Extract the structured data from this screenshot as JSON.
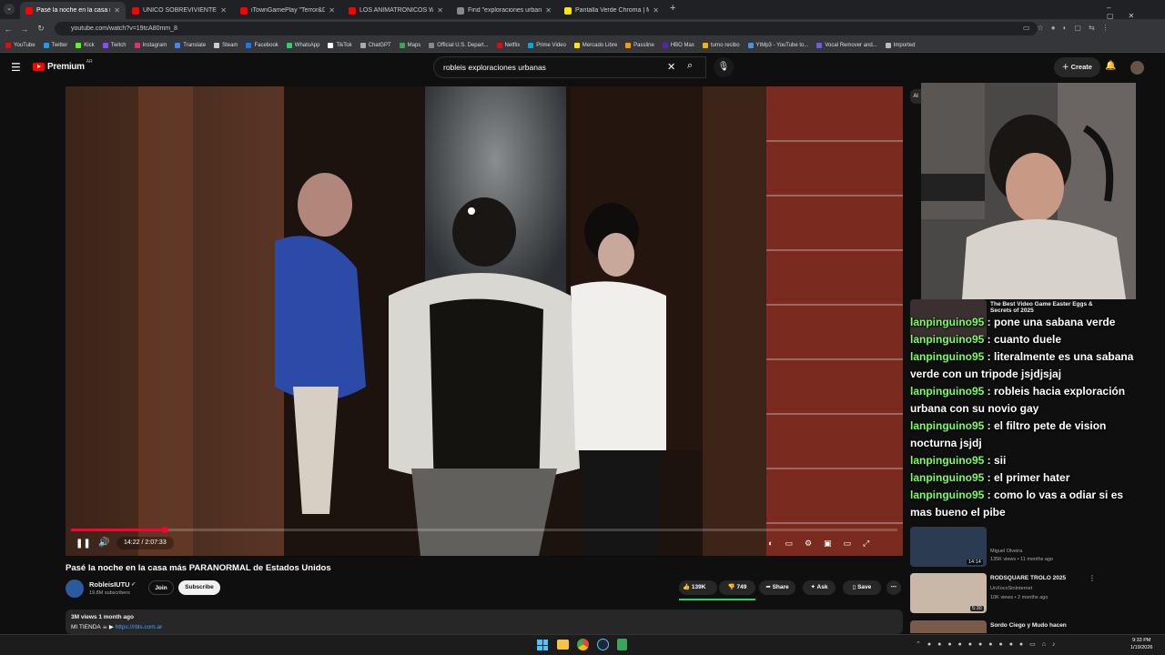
{
  "browser": {
    "tabs": [
      {
        "title": "Pasé la noche en la casa m",
        "color": "#ff0000",
        "active": true
      },
      {
        "title": "UNICO SOBREVIVIENTE | ATRAP",
        "color": "#ff0000"
      },
      {
        "title": "iTownGamePlay \"Terror&Divers",
        "color": "#ff0000"
      },
      {
        "title": "LOS ANIMATRÓNICOS WITHER",
        "color": "#ff0000"
      },
      {
        "title": "Find \"exploraciones urbanas\" o",
        "color": "#888888"
      },
      {
        "title": "Pantalla Verde Chroma | Merca",
        "color": "#ffe600"
      }
    ],
    "new_tab": "+",
    "url": "youtube.com/watch?v=19tcA80mm_8",
    "bookmarks": [
      {
        "label": "YouTube",
        "color": "#ff0000"
      },
      {
        "label": "Twitter",
        "color": "#1d9bf0"
      },
      {
        "label": "Kick",
        "color": "#53fc18"
      },
      {
        "label": "Twitch",
        "color": "#9146ff"
      },
      {
        "label": "Instagram",
        "color": "#e1306c"
      },
      {
        "label": "Translate",
        "color": "#4285f4"
      },
      {
        "label": "Steam",
        "color": "#cccccc"
      },
      {
        "label": "Facebook",
        "color": "#1877f2"
      },
      {
        "label": "WhatsApp",
        "color": "#25d366"
      },
      {
        "label": "TikTok",
        "color": "#ffffff"
      },
      {
        "label": "ChatGPT",
        "color": "#aaaaaa"
      },
      {
        "label": "Maps",
        "color": "#34a853"
      },
      {
        "label": "Official U.S. Depart...",
        "color": "#888888"
      },
      {
        "label": "Netflix",
        "color": "#e50914"
      },
      {
        "label": "Prime Video",
        "color": "#00a8e1"
      },
      {
        "label": "Mercado Libre",
        "color": "#ffe600"
      },
      {
        "label": "Passline",
        "color": "#ff9900"
      },
      {
        "label": "HBO Max",
        "color": "#5822b4"
      },
      {
        "label": "turno recibo",
        "color": "#f4b400"
      },
      {
        "label": "YtMp3 - YouTube to...",
        "color": "#4a90e2"
      },
      {
        "label": "Vocal Remover and...",
        "color": "#6c5ce7"
      },
      {
        "label": "Imported",
        "color": "#bbbbbb"
      }
    ]
  },
  "youtube": {
    "logo": "Premium",
    "logo_region": "AR",
    "search_value": "robleis exploraciones urbanas",
    "create_label": "Create"
  },
  "player": {
    "time": "14:22 / 2:07:33",
    "progress": 0.113
  },
  "video": {
    "title": "Pasé la noche en la casa más PARANORMAL de Estados Unidos",
    "channel": "RobleisIUTU",
    "subscribers": "19.8M subscribers",
    "join": "Join",
    "subscribe": "Subscribe",
    "likes": "139K",
    "dislikes": "749",
    "share": "Share",
    "ask": "Ask",
    "save": "Save",
    "views_date": "3M views  1 month ago",
    "desc_prefix": "MI TIENDA",
    "desc_link": "https://rbls.com.ar"
  },
  "chat": [
    {
      "user": "lanpinguino95",
      "msg": ": pone una sabana verde"
    },
    {
      "user": "lanpinguino95",
      "msg": ": cuanto duele"
    },
    {
      "user": "lanpinguino95",
      "msg": ": literalmente es una sabana verde con un tripode jsjdjsjaj"
    },
    {
      "user": "lanpinguino95",
      "msg": ": robleis hacia exploración urbana con su novio gay"
    },
    {
      "user": "lanpinguino95",
      "msg": ": el filtro pete de vision nocturna jsjdj"
    },
    {
      "user": "lanpinguino95",
      "msg": ": sii"
    },
    {
      "user": "lanpinguino95",
      "msg": ": el primer hater"
    },
    {
      "user": "lanpinguino95",
      "msg": ": como lo vas a odiar si es mas bueno el pibe"
    }
  ],
  "recommended": [
    {
      "title": "The Best Video Game Easter Eggs & Secrets of 2025",
      "channel": "",
      "meta": ""
    },
    {
      "title": "",
      "channel": "Miguel Olveira",
      "meta": "135K views • 11 months ago",
      "duration": "14:14"
    },
    {
      "title": "RODSQUARE TROLO 2025",
      "channel": "UnXocoSinInternet",
      "meta": "10K views • 2 months ago",
      "duration": "5:30"
    },
    {
      "title": "Sordo Ciego y Mudo hacen",
      "channel": "",
      "meta": ""
    }
  ],
  "taskbar": {
    "time": "9:33 PM",
    "date": "1/19/2026"
  }
}
